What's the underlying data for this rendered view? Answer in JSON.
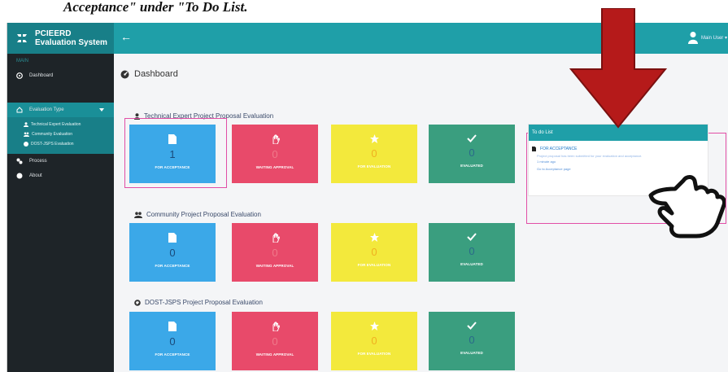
{
  "caption": "Acceptance\" under \"To Do List.",
  "header": {
    "brand_line1": "PCIEERD",
    "brand_line2": "Evaluation System",
    "back_icon": "arrow-left-icon",
    "user_name": "Main User ▾"
  },
  "sidebar": {
    "heading": "MAIN",
    "items": [
      {
        "label": "Dashboard",
        "icon": "dashboard-icon"
      },
      {
        "label": "Evaluation Type",
        "icon": "home-icon"
      },
      {
        "label": "Process",
        "icon": "process-icon"
      },
      {
        "label": "About",
        "icon": "info-icon"
      }
    ],
    "subitems": [
      {
        "label": "Technical Expert Evaluation",
        "icon": "user-icon"
      },
      {
        "label": "Community Evaluation",
        "icon": "users-icon"
      },
      {
        "label": "DOST-JSPS Evaluation",
        "icon": "globe-icon"
      }
    ]
  },
  "main": {
    "title": "Dashboard",
    "sections": [
      {
        "title": "Technical Expert Project Proposal Evaluation",
        "icon": "user-icon",
        "cards": [
          {
            "label": "FOR ACCEPTANCE",
            "value": "1",
            "color": "#3ba8e8",
            "icon": "file-icon"
          },
          {
            "label": "WAITING APPROVAL",
            "value": "0",
            "color": "#e84a6a",
            "icon": "hand-icon"
          },
          {
            "label": "FOR EVALUATION",
            "value": "0",
            "color": "#f3e93c",
            "icon": "star-icon"
          },
          {
            "label": "EVALUATED",
            "value": "0",
            "color": "#3a9e7f",
            "icon": "check-icon"
          }
        ]
      },
      {
        "title": "Community Project Proposal Evaluation",
        "icon": "users-icon",
        "cards": [
          {
            "label": "FOR ACCEPTANCE",
            "value": "0",
            "color": "#3ba8e8",
            "icon": "file-icon"
          },
          {
            "label": "WAITING APPROVAL",
            "value": "0",
            "color": "#e84a6a",
            "icon": "hand-icon"
          },
          {
            "label": "FOR EVALUATION",
            "value": "0",
            "color": "#f3e93c",
            "icon": "star-icon"
          },
          {
            "label": "EVALUATED",
            "value": "0",
            "color": "#3a9e7f",
            "icon": "check-icon"
          }
        ]
      },
      {
        "title": "DOST-JSPS Project Proposal Evaluation",
        "icon": "globe-icon",
        "cards": [
          {
            "label": "FOR ACCEPTANCE",
            "value": "0",
            "color": "#3ba8e8",
            "icon": "file-icon"
          },
          {
            "label": "WAITING APPROVAL",
            "value": "0",
            "color": "#e84a6a",
            "icon": "hand-icon"
          },
          {
            "label": "FOR EVALUATION",
            "value": "0",
            "color": "#f3e93c",
            "icon": "star-icon"
          },
          {
            "label": "EVALUATED",
            "value": "0",
            "color": "#3a9e7f",
            "icon": "check-icon"
          }
        ]
      }
    ]
  },
  "todo": {
    "title": "To do List",
    "item_label": "FOR ACCEPTANCE",
    "item_desc": "Project proposal has been submitted for your evaluation and acceptance.",
    "item_date": "1 minute ago",
    "link": "Go to Acceptance page"
  },
  "colors": {
    "accent": "#1f9fa8",
    "sidebar": "#1e2428",
    "highlight": "#e14ea6",
    "arrow": "#b51a1a"
  }
}
